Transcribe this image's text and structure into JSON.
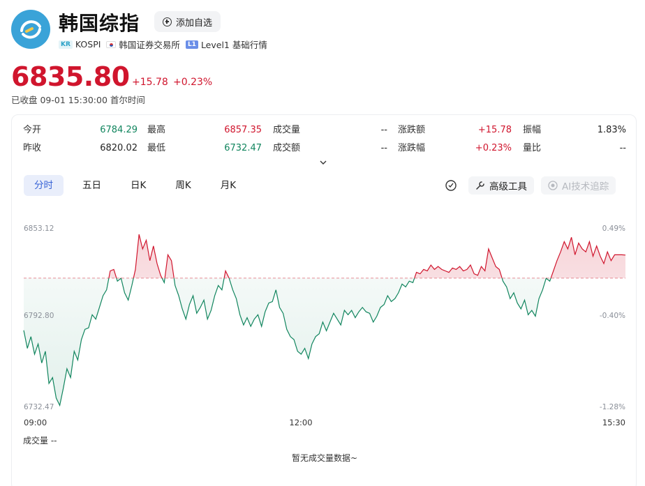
{
  "header": {
    "title": "韩国综指",
    "fav_label": "添加自选",
    "tags": {
      "country_badge": "KR",
      "code": "KOSPI",
      "exchange": "韩国证券交易所",
      "level_badge": "L1",
      "level_label": "Level1 基础行情"
    },
    "price": "6835.80",
    "change": "+15.78",
    "change_pct": "+0.23%",
    "status": "已收盘  09-01 15:30:00  首尔时间"
  },
  "stats": [
    {
      "label": "今开",
      "value": "6784.29",
      "tone": "green"
    },
    {
      "label": "昨收",
      "value": "6820.02",
      "tone": "dark"
    },
    {
      "label": "最高",
      "value": "6857.35",
      "tone": "red"
    },
    {
      "label": "最低",
      "value": "6732.47",
      "tone": "green"
    },
    {
      "label": "成交量",
      "value": "--",
      "tone": "dark"
    },
    {
      "label": "成交额",
      "value": "--",
      "tone": "dark"
    },
    {
      "label": "涨跌额",
      "value": "+15.78",
      "tone": "red"
    },
    {
      "label": "涨跌幅",
      "value": "+0.23%",
      "tone": "red"
    },
    {
      "label": "振幅",
      "value": "1.83%",
      "tone": "dark"
    },
    {
      "label": "量比",
      "value": "--",
      "tone": "dark"
    }
  ],
  "tabs": [
    "分时",
    "五日",
    "日K",
    "周K",
    "月K"
  ],
  "active_tab": 0,
  "tools": {
    "advanced_label": "高级工具",
    "ai_label": "AI技术追踪"
  },
  "colors": {
    "up": "#d0152d",
    "down": "#11855e",
    "accent": "#3863d6"
  },
  "chart_data": {
    "type": "line",
    "prev_close": 6820.02,
    "y_ticks": [
      "6853.12",
      "6792.80",
      "6732.47"
    ],
    "pct_ticks": [
      "0.49%",
      "-0.40%",
      "-1.28%"
    ],
    "ylim": [
      6732.47,
      6853.12
    ],
    "x_ticks": [
      "09:00",
      "12:00",
      "15:30"
    ],
    "series": [
      {
        "values": [
          6784.3,
          6772,
          6780,
          6768,
          6775,
          6762,
          6770,
          6748,
          6752,
          6738,
          6733,
          6745,
          6758,
          6752,
          6770,
          6764,
          6778,
          6785,
          6786,
          6795,
          6792,
          6800,
          6808,
          6812,
          6825,
          6826,
          6818,
          6820,
          6810,
          6805,
          6815,
          6826,
          6850,
          6840,
          6846,
          6832,
          6842,
          6830,
          6822,
          6817,
          6836,
          6832,
          6815,
          6808,
          6799,
          6792,
          6802,
          6808,
          6796,
          6800,
          6805,
          6792,
          6798,
          6808,
          6815,
          6812,
          6825,
          6820,
          6812,
          6806,
          6795,
          6788,
          6793,
          6787,
          6792,
          6795,
          6787,
          6797,
          6803,
          6804,
          6812,
          6800,
          6796,
          6785,
          6780,
          6778,
          6770,
          6768,
          6772,
          6765,
          6775,
          6780,
          6782,
          6790,
          6784,
          6790,
          6796,
          6792,
          6788,
          6798,
          6795,
          6798,
          6793,
          6797,
          6800,
          6797,
          6796,
          6790,
          6794,
          6800,
          6802,
          6808,
          6804,
          6806,
          6810,
          6816,
          6814,
          6818,
          6817,
          6824,
          6823,
          6826,
          6825,
          6829,
          6826,
          6828,
          6826,
          6825,
          6824,
          6827,
          6826,
          6828,
          6825,
          6826,
          6829,
          6823,
          6822,
          6828,
          6825,
          6840,
          6834,
          6828,
          6826,
          6818,
          6814,
          6806,
          6810,
          6803,
          6799,
          6805,
          6795,
          6798,
          6794,
          6806,
          6812,
          6820,
          6818,
          6825,
          6832,
          6838,
          6845,
          6840,
          6848,
          6836,
          6844,
          6840,
          6838,
          6845,
          6835,
          6842,
          6835,
          6830,
          6838,
          6832,
          6836,
          6836,
          6836,
          6835.8
        ]
      }
    ]
  },
  "volume": {
    "label": "成交量 --",
    "empty": "暂无成交量数据~"
  }
}
